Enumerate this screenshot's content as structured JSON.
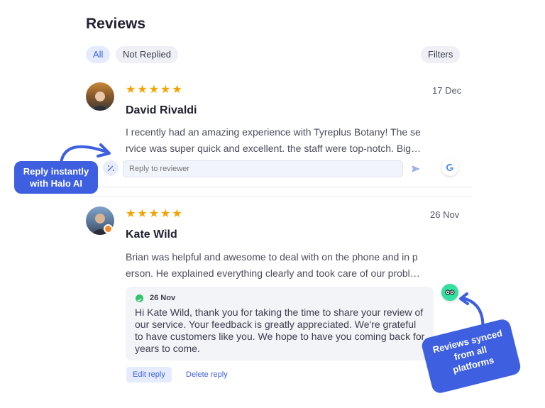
{
  "page": {
    "title": "Reviews"
  },
  "filters": {
    "all": "All",
    "not_replied": "Not Replied",
    "filters_button": "Filters"
  },
  "colors": {
    "accent": "#3d5fe0",
    "star": "#f5a300",
    "check": "#2fc56a"
  },
  "reviews": [
    {
      "stars": 5,
      "date": "17 Dec",
      "name": "David Rivaldi",
      "text_line1": "I recently had an amazing experience with Tyreplus Botany! The se",
      "text_line2": "rvice was super quick and excellent. the staff were top-notch. Big…",
      "reply_placeholder": "Reply to reviewer",
      "source_icon": "google-icon"
    },
    {
      "stars": 5,
      "date": "26 Nov",
      "name": "Kate Wild",
      "text_line1": "Brian was helpful and awesome to deal with on the phone and in p",
      "text_line2": "erson. He explained everything clearly and took care of our probl…",
      "source_icon": "tripadvisor-icon",
      "reply": {
        "date": "26 Nov",
        "text": "Hi Kate Wild, thank you for taking the time to share your review of our service. Your feedback is greatly appreciated. We're grateful to have customers like you. We hope to have you coming back for years to come."
      },
      "actions": {
        "edit": "Edit reply",
        "delete": "Delete reply"
      }
    }
  ],
  "callouts": {
    "left_line1": "Reply instantly",
    "left_line2": "with Halo AI",
    "right_line1": "Reviews synced",
    "right_line2": "from all",
    "right_line3": "platforms"
  }
}
